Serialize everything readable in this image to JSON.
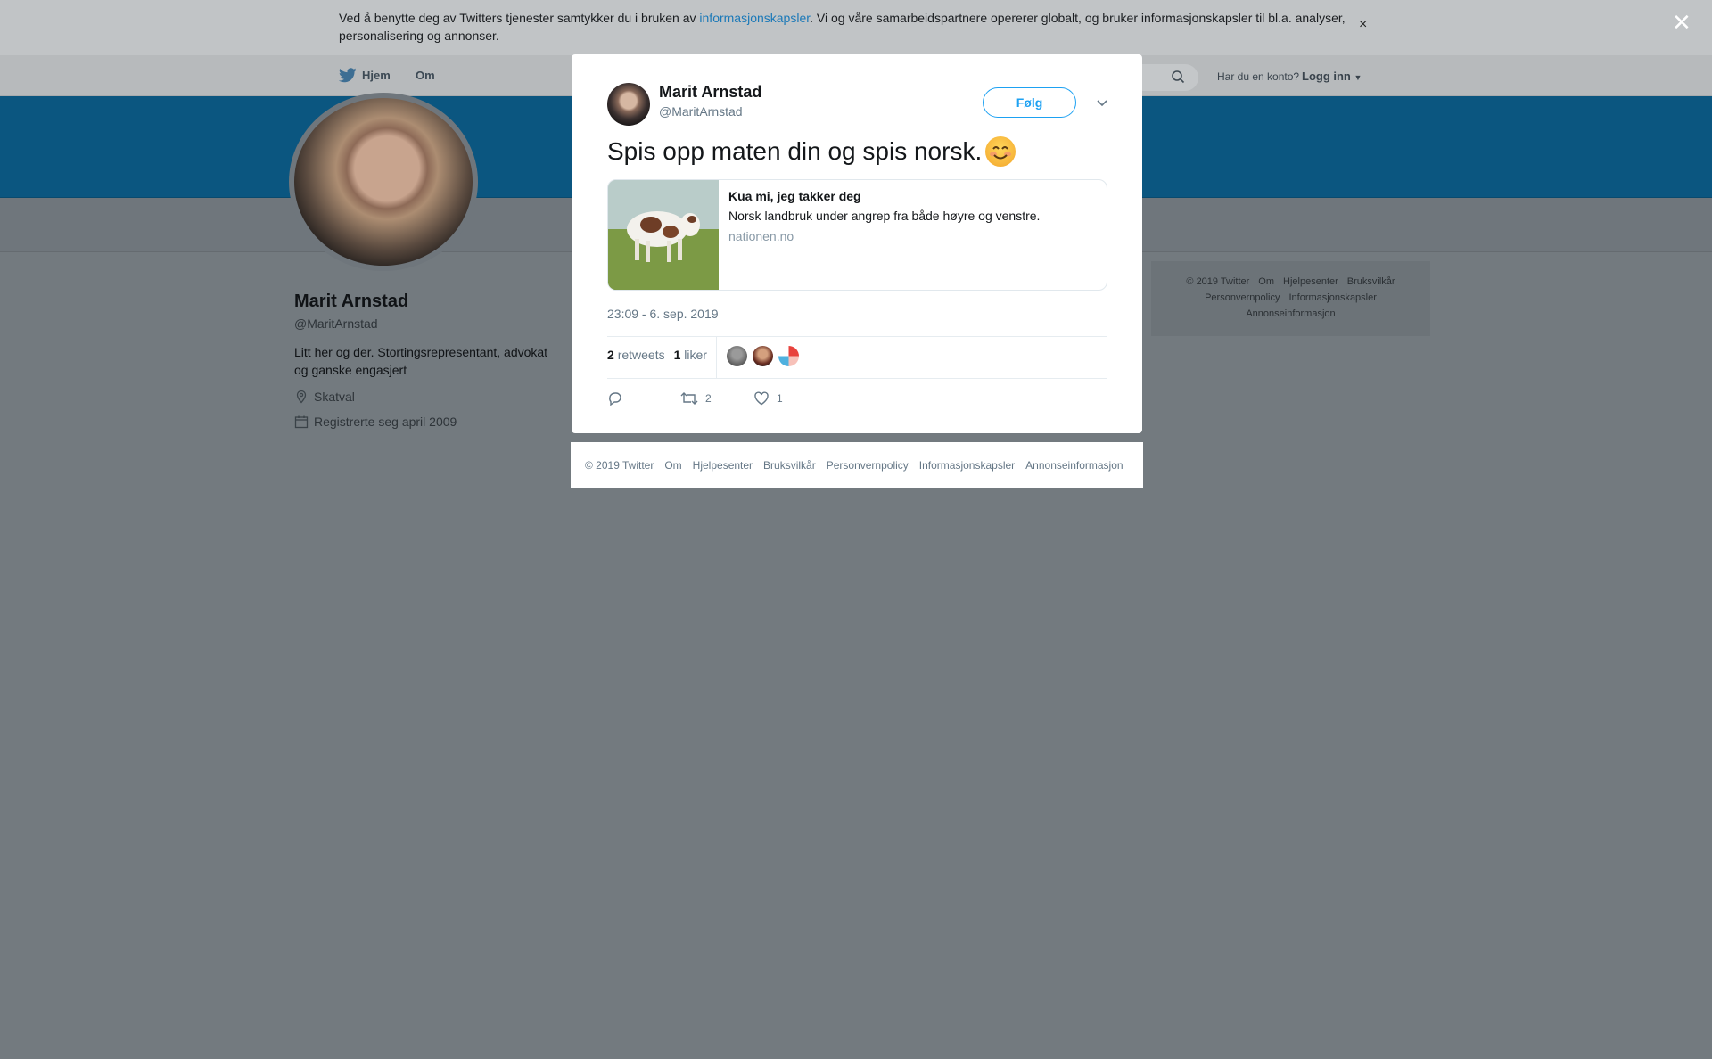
{
  "cookie_banner": {
    "text_before": "Ved å benytte deg av Twitters tjenester samtykker du i bruken av ",
    "link": "informasjonskapsler",
    "text_after": ". Vi og våre samarbeidspartnere opererer globalt, og bruker informasjonskapsler til bl.a. analyser, personalisering og annonser.",
    "close_icon": "×"
  },
  "nav": {
    "home": "Hjem",
    "about": "Om",
    "account_question": "Har du en konto?",
    "login": "Logg inn"
  },
  "profile": {
    "name": "Marit Arnstad",
    "handle": "@MaritArnstad",
    "bio": "Litt her og der. Stortingsrepresentant, advokat og ganske engasjert",
    "location": "Skatval",
    "joined": "Registrerte seg april 2009"
  },
  "side_footer": {
    "items": [
      "© 2019 Twitter",
      "Om",
      "Hjelpesenter",
      "Bruksvilkår",
      "Personvernpolicy",
      "Informasjonskapsler",
      "Annonseinformasjon"
    ]
  },
  "overlay_close_icon": "✕",
  "tweet": {
    "author_name": "Marit Arnstad",
    "author_handle": "@MaritArnstad",
    "follow_label": "Følg",
    "text": "Spis opp maten din og spis norsk.",
    "card": {
      "title": "Kua mi, jeg takker deg",
      "description": "Norsk landbruk under angrep fra både høyre og venstre.",
      "domain": "nationen.no"
    },
    "timestamp": "23:09 - 6. sep. 2019",
    "retweets_count": "2",
    "retweets_label": "retweets",
    "likes_count": "1",
    "likes_label": "liker",
    "actions": {
      "retweet_count": "2",
      "like_count": "1"
    }
  },
  "modal_footer": {
    "items": [
      "© 2019 Twitter",
      "Om",
      "Hjelpesenter",
      "Bruksvilkår",
      "Personvernpolicy",
      "Informasjonskapsler",
      "Annonseinformasjon"
    ]
  },
  "colors": {
    "accent": "#1da1f2",
    "overlay": "#737a7f",
    "banner": "#0b5680"
  }
}
